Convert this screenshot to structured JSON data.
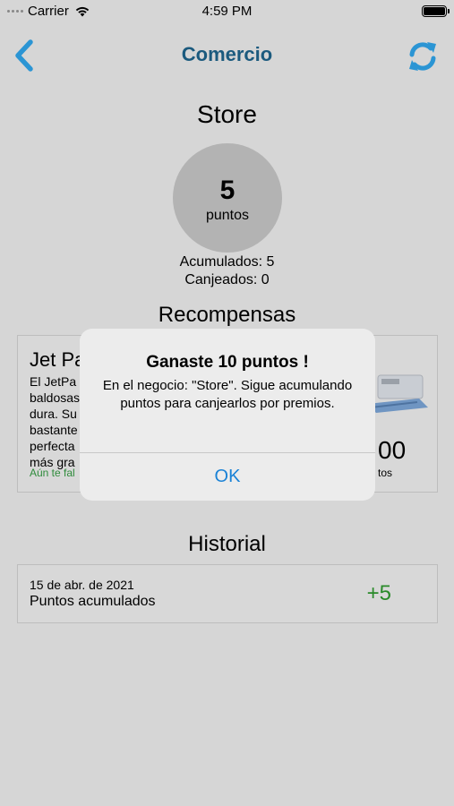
{
  "status_bar": {
    "carrier": "Carrier",
    "time": "4:59 PM"
  },
  "nav": {
    "title": "Comercio",
    "back_icon": "chevron-left-icon",
    "refresh_icon": "refresh-icon",
    "accent_color": "#2b95d4"
  },
  "store": {
    "title": "Store",
    "points_value": "5",
    "points_label": "puntos",
    "accumulated": "Acumulados: 5",
    "redeemed": "Canjeados: 0"
  },
  "rewards": {
    "title": "Recompensas",
    "items": [
      {
        "name": "Jet Pa",
        "description_lines": [
          "El JetPa",
          "baldosas",
          "dura. Su",
          "bastante",
          "perfecta",
          "más gra"
        ],
        "missing_text": "Aún te fal",
        "cost": "00",
        "cost_label": "tos"
      }
    ]
  },
  "history": {
    "title": "Historial",
    "entries": [
      {
        "date": "15 de abr. de 2021",
        "description": "Puntos acumulados",
        "points": "+5"
      }
    ]
  },
  "alert": {
    "title": "Ganaste 10 puntos !",
    "message": "En el negocio: \"Store\". Sigue acumulando puntos para canjearlos por premios.",
    "ok_label": "OK"
  }
}
